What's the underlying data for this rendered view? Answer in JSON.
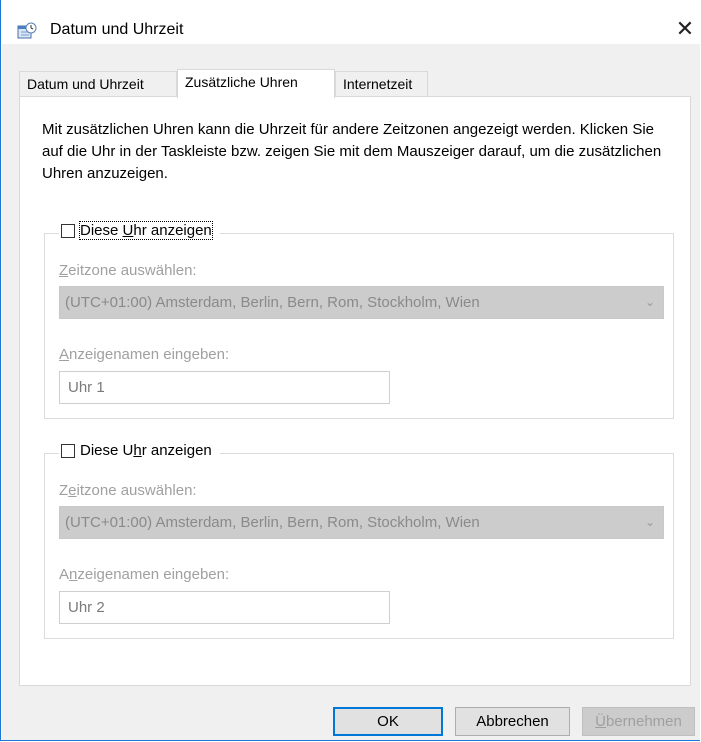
{
  "window": {
    "title": "Datum und Uhrzeit",
    "close_glyph": "✕"
  },
  "tabs": [
    {
      "label": "Datum und Uhrzeit",
      "active": false
    },
    {
      "label": "Zusätzliche Uhren",
      "active": true
    },
    {
      "label": "Internetzeit",
      "active": false
    }
  ],
  "intro_text": "Mit zusätzlichen Uhren kann die Uhrzeit für andere Zeitzonen angezeigt werden. Klicken Sie auf die Uhr in der Taskleiste bzw. zeigen Sie mit dem Mauszeiger darauf, um die zusätzlichen Uhren anzuzeigen.",
  "clocks": [
    {
      "checkbox_label_before": "Diese ",
      "checkbox_label_accel": "U",
      "checkbox_label_after": "hr anzeigen",
      "checked": false,
      "timezone_label_accel": "Z",
      "timezone_label_rest": "eitzone auswählen:",
      "timezone_value": "(UTC+01:00) Amsterdam, Berlin, Bern, Rom, Stockholm, Wien",
      "name_label_accel": "A",
      "name_label_rest": "nzeigenamen eingeben:",
      "name_value": "Uhr 1"
    },
    {
      "checkbox_label_before": "Diese U",
      "checkbox_label_accel": "h",
      "checkbox_label_after": "r anzeigen",
      "checked": false,
      "timezone_label_before": "Z",
      "timezone_label_accel": "e",
      "timezone_label_rest": "itzone auswählen:",
      "timezone_value": "(UTC+01:00) Amsterdam, Berlin, Bern, Rom, Stockholm, Wien",
      "name_label_before": "A",
      "name_label_accel": "n",
      "name_label_rest": "zeigenamen eingeben:",
      "name_value": "Uhr 2"
    }
  ],
  "buttons": {
    "ok": "OK",
    "cancel": "Abbrechen",
    "apply_accel": "Ü",
    "apply_rest": "bernehmen"
  },
  "colors": {
    "accent": "#0078d7",
    "window_border": "#1b78d4",
    "disabled_text": "#a0a0a0",
    "disabled_field": "#cccccc"
  },
  "icons": {
    "app": "calendar-clock-icon",
    "close": "close-icon",
    "dropdown": "chevron-down-icon"
  }
}
